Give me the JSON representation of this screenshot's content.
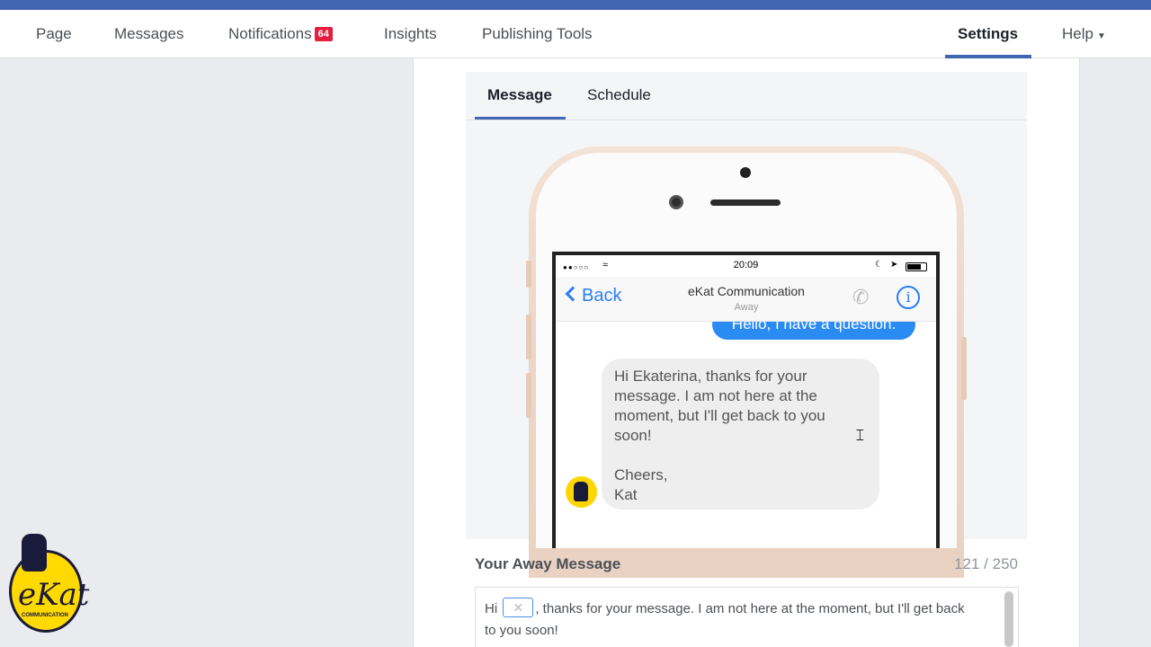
{
  "nav": {
    "items": [
      {
        "label": "Page"
      },
      {
        "label": "Messages"
      },
      {
        "label": "Notifications",
        "badge": "64"
      },
      {
        "label": "Insights"
      },
      {
        "label": "Publishing Tools"
      },
      {
        "label": "Settings"
      },
      {
        "label": "Help"
      }
    ],
    "active": "Settings"
  },
  "tabs": [
    {
      "label": "Message"
    },
    {
      "label": "Schedule"
    }
  ],
  "preview": {
    "status_time": "20:09",
    "back_label": "Back",
    "chat_name": "eKat Communication",
    "chat_status": "Away",
    "outgoing_message": "Hello, I have a question.",
    "incoming_message": "Hi Ekaterina, thanks for your message. I am not here at the moment, but I'll get back to you soon!\n\nCheers,\nKat"
  },
  "away": {
    "label": "Your Away Message",
    "count": "121 / 250",
    "text_before": "Hi",
    "text_after": ", thanks for your message. I am not here at the moment, but I'll get back to you soon!"
  },
  "logo": {
    "text": "eKat",
    "subtext": "COMMUNICATION"
  },
  "colors": {
    "brand": "#4267b2",
    "badge": "#e41e3f",
    "bubble_out": "#2a8bf2",
    "logo_yellow": "#ffd900"
  }
}
